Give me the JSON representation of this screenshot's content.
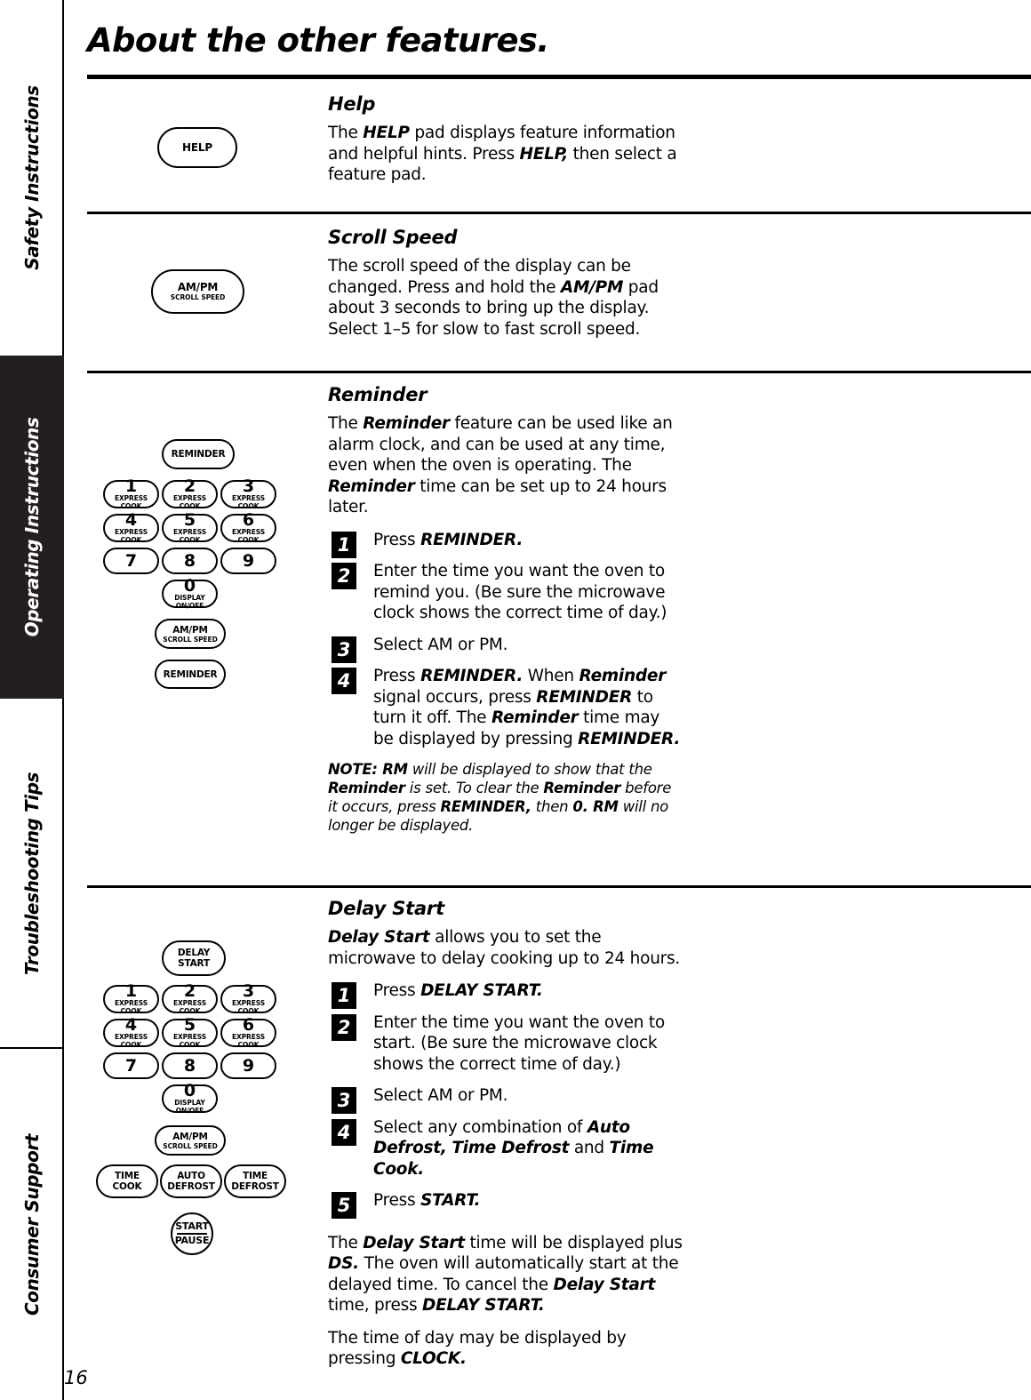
{
  "sidebar": {
    "tabs": [
      {
        "label": "Safety Instructions",
        "style": "light"
      },
      {
        "label": "Operating Instructions",
        "style": "dark"
      },
      {
        "label": "Troubleshooting Tips",
        "style": "light"
      },
      {
        "label": "Consumer Support",
        "style": "light"
      }
    ]
  },
  "page": {
    "title": "About the other features.",
    "page_number": "16"
  },
  "sections": {
    "help": {
      "heading": "Help",
      "body": "The HELP pad displays feature information and helpful hints. Press HELP, then select a feature pad.",
      "pad": {
        "label": "HELP"
      }
    },
    "scroll_speed": {
      "heading": "Scroll Speed",
      "body": "The scroll speed of the display can be changed. Press and hold the AM/PM pad about 3 seconds to bring up the display. Select 1–5 for slow to fast scroll speed.",
      "pad": {
        "label": "AM/PM",
        "sublabel": "SCROLL SPEED"
      }
    },
    "reminder": {
      "heading": "Reminder",
      "body": "The Reminder feature can be used like an alarm clock, and can be used at any time, even when the oven is operating. The Reminder time can be set up to 24 hours later.",
      "steps": [
        {
          "num": "1",
          "text": "Press REMINDER."
        },
        {
          "num": "2",
          "text": "Enter the time you want the oven to remind you. (Be sure the microwave clock shows the correct time of day.)"
        },
        {
          "num": "3",
          "text": "Select AM or PM."
        },
        {
          "num": "4",
          "text": "Press REMINDER. When Reminder signal occurs, press REMINDER to turn it off. The Reminder time may be displayed by pressing REMINDER."
        }
      ],
      "note": "NOTE: RM will be displayed to show that the Reminder is set. To clear the Reminder before it occurs, press REMINDER, then 0. RM will no longer be displayed."
    },
    "delay_start": {
      "heading": "Delay Start",
      "body": "Delay Start allows you to set the microwave to delay cooking up to 24 hours.",
      "steps": [
        {
          "num": "1",
          "text": "Press DELAY START."
        },
        {
          "num": "2",
          "text": "Enter the time you want the oven to start. (Be sure the microwave clock shows the correct time of day.)"
        },
        {
          "num": "3",
          "text": "Select AM or PM."
        },
        {
          "num": "4",
          "text": "Select any combination of Auto Defrost, Time Defrost and Time Cook."
        },
        {
          "num": "5",
          "text": "Press START."
        }
      ],
      "closing_1": "The Delay Start time will be displayed plus DS. The oven will automatically start at the delayed time. To cancel the Delay Start time, press DELAY START.",
      "closing_2": "The time of day may be displayed by pressing CLOCK."
    }
  },
  "keypads": {
    "reminder": {
      "top": {
        "label": "REMINDER"
      },
      "numbers": [
        {
          "digit": "1",
          "sub": "EXPRESS COOK"
        },
        {
          "digit": "2",
          "sub": "EXPRESS COOK"
        },
        {
          "digit": "3",
          "sub": "EXPRESS COOK"
        },
        {
          "digit": "4",
          "sub": "EXPRESS COOK"
        },
        {
          "digit": "5",
          "sub": "EXPRESS COOK"
        },
        {
          "digit": "6",
          "sub": "EXPRESS COOK"
        },
        {
          "digit": "7",
          "sub": ""
        },
        {
          "digit": "8",
          "sub": ""
        },
        {
          "digit": "9",
          "sub": ""
        }
      ],
      "zero": {
        "digit": "0",
        "sub": "DISPLAY ON/OFF"
      },
      "ampm": {
        "label": "AM/PM",
        "sublabel": "SCROLL SPEED"
      },
      "bottom": {
        "label": "REMINDER"
      }
    },
    "delay_start": {
      "top": {
        "line1": "DELAY",
        "line2": "START"
      },
      "numbers": [
        {
          "digit": "1",
          "sub": "EXPRESS COOK"
        },
        {
          "digit": "2",
          "sub": "EXPRESS COOK"
        },
        {
          "digit": "3",
          "sub": "EXPRESS COOK"
        },
        {
          "digit": "4",
          "sub": "EXPRESS COOK"
        },
        {
          "digit": "5",
          "sub": "EXPRESS COOK"
        },
        {
          "digit": "6",
          "sub": "EXPRESS COOK"
        },
        {
          "digit": "7",
          "sub": ""
        },
        {
          "digit": "8",
          "sub": ""
        },
        {
          "digit": "9",
          "sub": ""
        }
      ],
      "zero": {
        "digit": "0",
        "sub": "DISPLAY ON/OFF"
      },
      "ampm": {
        "label": "AM/PM",
        "sublabel": "SCROLL SPEED"
      },
      "row_bottom": [
        {
          "line1": "TIME",
          "line2": "COOK"
        },
        {
          "line1": "AUTO",
          "line2": "DEFROST"
        },
        {
          "line1": "TIME",
          "line2": "DEFROST"
        }
      ],
      "start": {
        "line1": "START",
        "line2": "PAUSE"
      }
    }
  }
}
